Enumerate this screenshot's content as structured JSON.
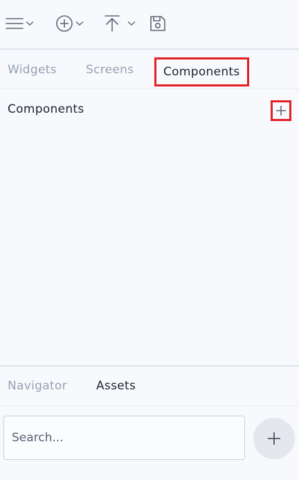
{
  "toolbar": {
    "menu_icon": "hamburger-menu-icon",
    "add_icon": "plus-circle-icon",
    "upload_icon": "upload-arrow-icon",
    "save_icon": "save-disk-icon",
    "chevron_icon": "chevron-down-icon"
  },
  "tabs": {
    "items": [
      {
        "label": "Widgets"
      },
      {
        "label": "Screens"
      },
      {
        "label": "Components"
      }
    ],
    "active": "Components"
  },
  "panel": {
    "title": "Components",
    "add_icon": "plus-icon"
  },
  "bottom_tabs": {
    "items": [
      {
        "label": "Navigator"
      },
      {
        "label": "Assets"
      }
    ],
    "active": "Assets"
  },
  "search": {
    "placeholder": "Search...",
    "value": ""
  },
  "fab": {
    "icon": "plus-icon"
  },
  "colors": {
    "background": "#f8f9fc",
    "highlight": "#e31e24",
    "inactive_tab": "#95a1b3",
    "active_tab": "#1d2330"
  }
}
